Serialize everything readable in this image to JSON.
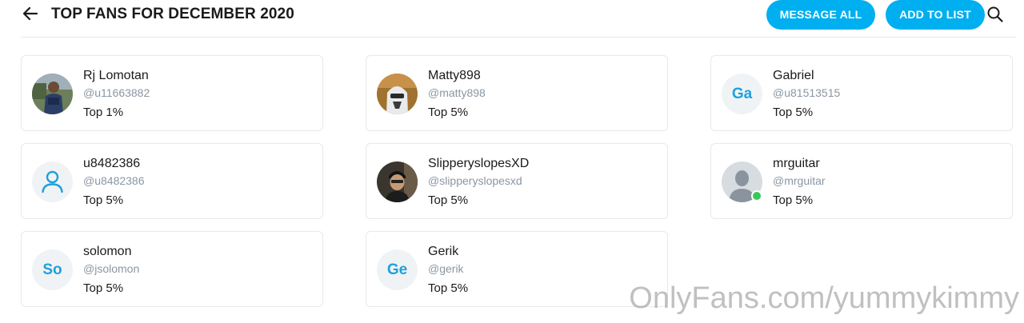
{
  "header": {
    "title": "TOP FANS FOR DECEMBER 2020",
    "message_all_label": "MESSAGE ALL",
    "add_to_list_label": "ADD TO LIST"
  },
  "colors": {
    "accent": "#00aff0",
    "online": "#37c95b",
    "muted_text": "#8a96a3"
  },
  "fans": [
    {
      "name": "Rj Lomotan",
      "handle": "@u11663882",
      "rank": "Top 1%",
      "avatar": "photo"
    },
    {
      "name": "Matty898",
      "handle": "@matty898",
      "rank": "Top 5%",
      "avatar": "photo"
    },
    {
      "name": "Gabriel",
      "handle": "@u81513515",
      "rank": "Top 5%",
      "avatar": "initials",
      "initials": "Ga"
    },
    {
      "name": "u8482386",
      "handle": "@u8482386",
      "rank": "Top 5%",
      "avatar": "user-outline-icon"
    },
    {
      "name": "SlipperyslopesXD",
      "handle": "@slipperyslopesxd",
      "rank": "Top 5%",
      "avatar": "photo"
    },
    {
      "name": "mrguitar",
      "handle": "@mrguitar",
      "rank": "Top 5%",
      "avatar": "default-silhouette",
      "online": true
    },
    {
      "name": "solomon",
      "handle": "@jsolomon",
      "rank": "Top 5%",
      "avatar": "initials",
      "initials": "So"
    },
    {
      "name": "Gerik",
      "handle": "@gerik",
      "rank": "Top 5%",
      "avatar": "initials",
      "initials": "Ge"
    }
  ],
  "watermark": "OnlyFans.com/yummykimmy"
}
